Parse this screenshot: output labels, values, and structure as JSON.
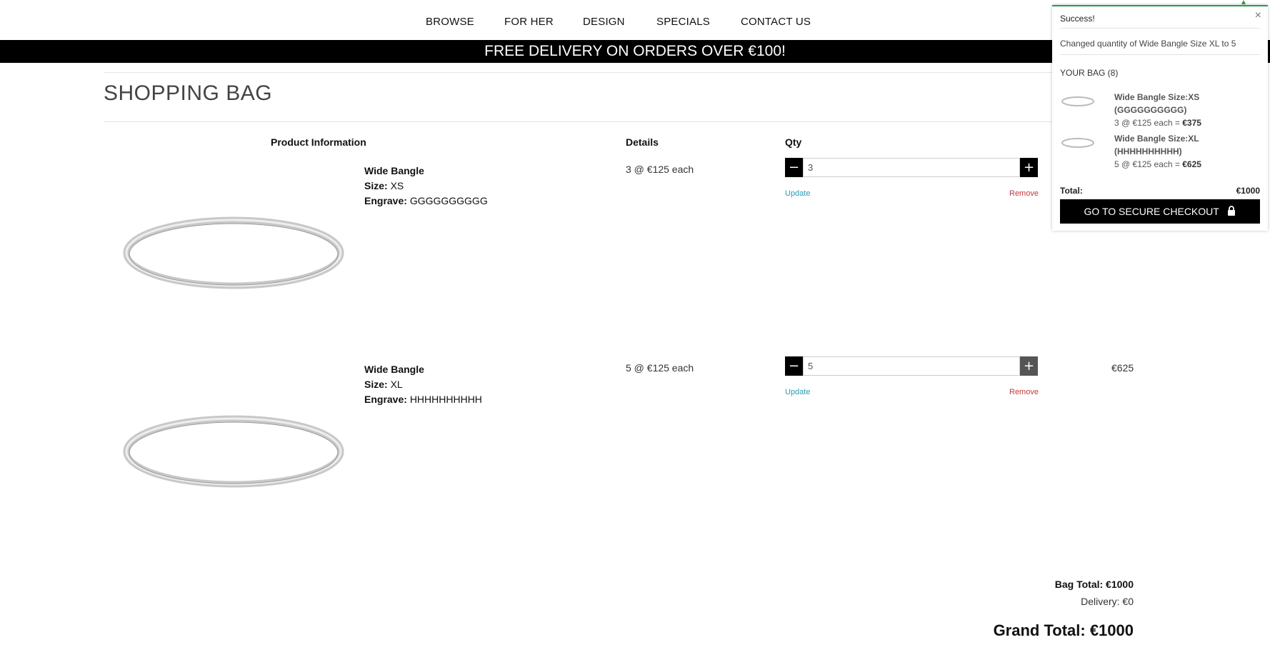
{
  "nav": {
    "items": [
      {
        "label": "BROWSE"
      },
      {
        "label": "FOR HER"
      },
      {
        "label": "DESIGN"
      },
      {
        "label": "SPECIALS"
      },
      {
        "label": "CONTACT US"
      }
    ]
  },
  "banner": {
    "text": "FREE DELIVERY ON ORDERS OVER €100!"
  },
  "page": {
    "title": "SHOPPING BAG"
  },
  "table": {
    "headers": {
      "product": "Product Information",
      "details": "Details",
      "qty": "Qty"
    }
  },
  "items": [
    {
      "name": "Wide Bangle",
      "size_label": "Size:",
      "size": "XS",
      "engrave_label": "Engrave:",
      "engrave": "GGGGGGGGGG",
      "details": "3 @ €125 each",
      "qty": "3",
      "update": "Update",
      "remove": "Remove",
      "line_total": ""
    },
    {
      "name": "Wide Bangle",
      "size_label": "Size:",
      "size": "XL",
      "engrave_label": "Engrave:",
      "engrave": "HHHHHHHHHH",
      "details": "5 @ €125 each",
      "qty": "5",
      "update": "Update",
      "remove": "Remove",
      "line_total": "€625"
    }
  ],
  "totals": {
    "bag": "Bag Total: €1000",
    "delivery": "Delivery: €0",
    "grand": "Grand Total: €1000"
  },
  "popup": {
    "header": "Success!",
    "close": "×",
    "message": "Changed quantity of Wide Bangle Size XL to 5",
    "bag_label": "YOUR BAG (8)",
    "items": [
      {
        "name_line1": "Wide Bangle Size:XS",
        "name_line2": "(GGGGGGGGGG)",
        "qty_price": "3 @ €125 each = ",
        "total": "€375"
      },
      {
        "name_line1": "Wide Bangle Size:XL",
        "name_line2": "(HHHHHHHHHH)",
        "qty_price": "5 @ €125 each = ",
        "total": "€625"
      }
    ],
    "total_label": "Total:",
    "total_value": "€1000",
    "checkout_label": "GO TO SECURE CHECKOUT"
  },
  "colors": {
    "accent_success": "#2a9a4a",
    "update_link": "#2a9bb5",
    "remove_link": "#c0393b"
  }
}
